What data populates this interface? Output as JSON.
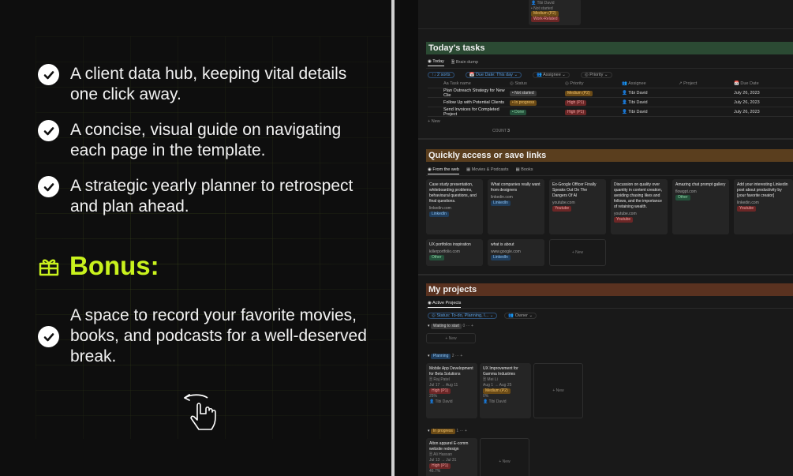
{
  "features": [
    "A client data hub, keeping vital details one click away.",
    "A concise, visual guide on navigating each page in the template.",
    "A strategic yearly planner to retrospect and plan ahead."
  ],
  "bonus": {
    "title": "Bonus:",
    "item": "A space to record your favorite movies, books, and podcasts for a well-deserved break."
  },
  "top_strip": {
    "items": [
      "Tibi David",
      "Not started",
      "Medium (P2)",
      "Work-Related"
    ]
  },
  "tasks": {
    "title": "Today's tasks",
    "tabs": [
      "Today",
      "Brain dump"
    ],
    "filters": [
      "↑↓ 2 sorts",
      "Due Date: This day",
      "Assignee",
      "Priority"
    ],
    "columns": [
      "Task name",
      "Status",
      "Priority",
      "Assignee",
      "Project",
      "Due Date"
    ],
    "rows": [
      {
        "name": "Plan Outreach Strategy for New Clie",
        "status": "Not started",
        "priority": "Medium (P2)",
        "assignee": "Tibi David",
        "due": "July 26, 2023"
      },
      {
        "name": "Follow Up with Potential Clients",
        "status": "In progress",
        "priority": "High (P1)",
        "assignee": "Tibi David",
        "due": "July 26, 2023"
      },
      {
        "name": "Send Invoices for Completed Project",
        "status": "Done",
        "priority": "High (P1)",
        "assignee": "Tibi David",
        "due": "July 26, 2023"
      }
    ],
    "new_label": "+ New",
    "count_label": "COUNT",
    "count_value": "3"
  },
  "links": {
    "title": "Quickly access or save links",
    "tabs": [
      "From the web",
      "Movies & Podcasts",
      "Books"
    ],
    "cards": [
      {
        "title": "Case study presentation, whiteboarding problems, behavioural questions, and final questions.",
        "domain": "linkedin.com",
        "tag": "LinkedIn"
      },
      {
        "title": "What companies really want from designers",
        "domain": "linkedin.com",
        "tag": "LinkedIn"
      },
      {
        "title": "Ex-Google Officer Finally Speaks Out On The Dangers Of AI",
        "domain": "youtube.com",
        "tag": "Youtube"
      },
      {
        "title": "Discussion on quality over quantity in content creation, avoiding chasing likes and follows, and the importance of retaining wealth.",
        "domain": "youtube.com",
        "tag": "Youtube"
      },
      {
        "title": "Amazing chat prompt gallery",
        "domain": "flowgpt.com",
        "tag": "Other"
      },
      {
        "title": "Add your interesting Linkedin post about productivity by [your favorite creator]",
        "domain": "linkedin.com",
        "tag": "Youtube"
      },
      {
        "title": "UX portfolios inspiration",
        "domain": "killerportfolio.com",
        "tag": "Other"
      },
      {
        "title": "what is about",
        "domain": "www.google.com",
        "tag": "LinkedIn"
      }
    ],
    "new_label": "+ New"
  },
  "projects": {
    "title": "My projects",
    "tabs": [
      "Active Projects"
    ],
    "filters": [
      "Status: To-do, Planning, I...",
      "Owner"
    ],
    "groups": [
      {
        "name": "Waiting to start",
        "count": "0"
      },
      {
        "name": "Planning",
        "count": "2"
      },
      {
        "name": "In progress",
        "count": "1"
      }
    ],
    "cards": [
      {
        "title": "Mobile App Development for Beta Solutions",
        "owner": "Raj Patel",
        "dates": "Jul 17 → Aug 11",
        "priority": "High (P1)",
        "progress": "25%",
        "assignee": "Tibi David"
      },
      {
        "title": "UX Improvement for Gamma Industries",
        "owner": "Mei Li",
        "dates": "Aug 1 → Aug 25",
        "priority": "Medium (P2)",
        "progress": "0%",
        "assignee": "Tibi David"
      },
      {
        "title": "Alton apparel E-comm website redesign",
        "owner": "Ali Hassan",
        "dates": "Jul 13 → Jul 31",
        "priority": "High (P1)",
        "progress": "46.7%"
      }
    ],
    "new_label": "+ New"
  },
  "colors": {
    "accent": "#c9f21d",
    "tasks_banner": "#2b4a33",
    "links_banner": "#5a3e1e",
    "projects_banner": "#5a3220"
  }
}
